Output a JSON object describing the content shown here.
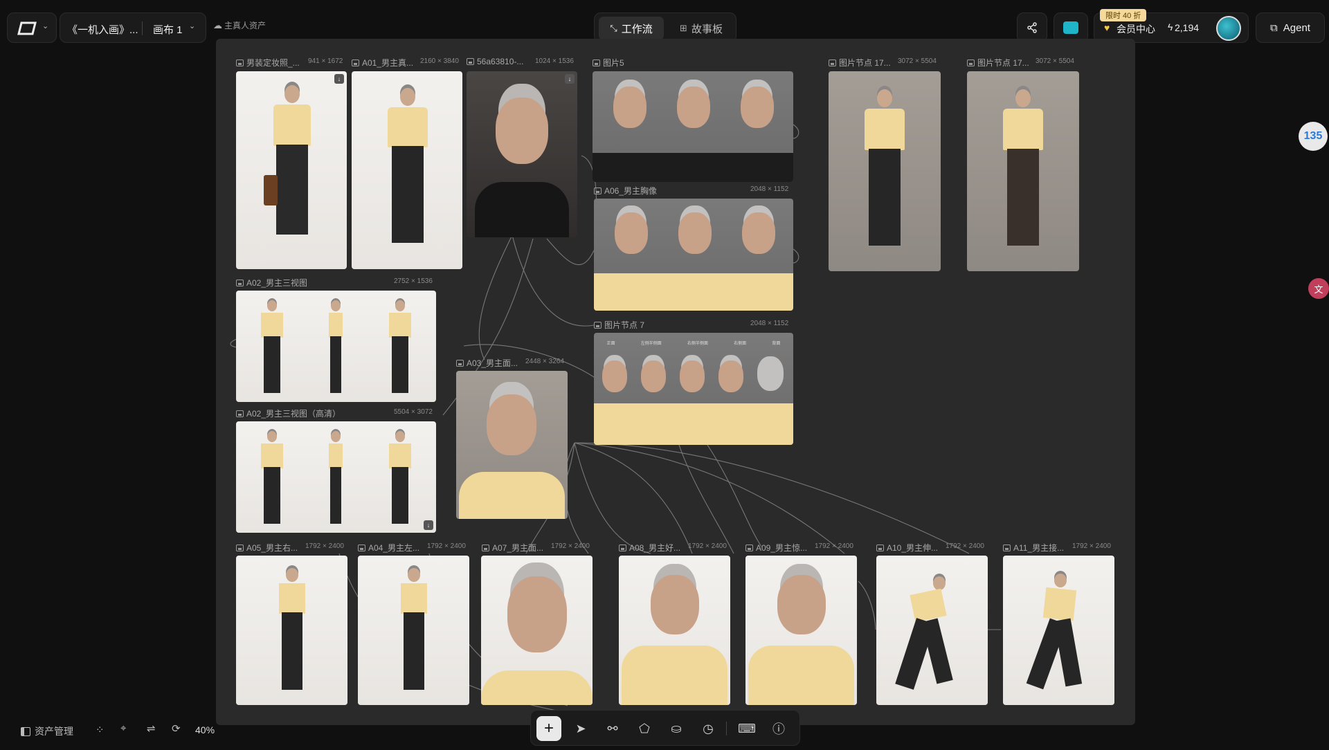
{
  "topbar": {
    "project_title": "《一机入画》...",
    "canvas_selector": "画布 1",
    "assets_link": "主真人资产",
    "tab_workflow": "工作流",
    "tab_storyboard": "故事板",
    "promo_badge": "限时 40 折",
    "member_center": "会员中心",
    "credits": "2,194",
    "agent_label": "Agent"
  },
  "nodes": [
    {
      "label": "男装定妆照_...",
      "dims": "941 × 1672"
    },
    {
      "label": "A01_男主真...",
      "dims": "2160 × 3840"
    },
    {
      "label": "56a63810-...",
      "dims": "1024 × 1536"
    },
    {
      "label": "图片5",
      "dims": ""
    },
    {
      "label": "A06_男主胸像",
      "dims": "2048 × 1152"
    },
    {
      "label": "图片节点 7",
      "dims": "2048 × 1152"
    },
    {
      "label": "图片节点 17...",
      "dims": "3072 × 5504"
    },
    {
      "label": "图片节点 17...",
      "dims": "3072 × 5504"
    },
    {
      "label": "A02_男主三视图",
      "dims": "2752 × 1536"
    },
    {
      "label": "A03_男主面...",
      "dims": "2448 × 3264"
    },
    {
      "label": "A02_男主三视图（高清）",
      "dims": "5504 × 3072"
    },
    {
      "label": "A05_男主右...",
      "dims": "1792 × 2400"
    },
    {
      "label": "A04_男主左...",
      "dims": "1792 × 2400"
    },
    {
      "label": "A07_男主面...",
      "dims": "1792 × 2400"
    },
    {
      "label": "A08_男主好...",
      "dims": "1792 × 2400"
    },
    {
      "label": "A09_男主惊...",
      "dims": "1792 × 2400"
    },
    {
      "label": "A10_男主伸...",
      "dims": "1792 × 2400"
    },
    {
      "label": "A11_男主接...",
      "dims": "1792 × 2400"
    }
  ],
  "angles_header": [
    "正面",
    "左侧半侧面",
    "右侧半侧面",
    "右侧面",
    "背面"
  ],
  "bottom_left": {
    "asset_manager": "资产管理",
    "zoom": "40%"
  },
  "side_badge": "135",
  "colors": {
    "background": "#101010",
    "canvas": "#2a2a2a",
    "accent_member": "#f5c84b",
    "store_button": "#1fb5c9"
  }
}
